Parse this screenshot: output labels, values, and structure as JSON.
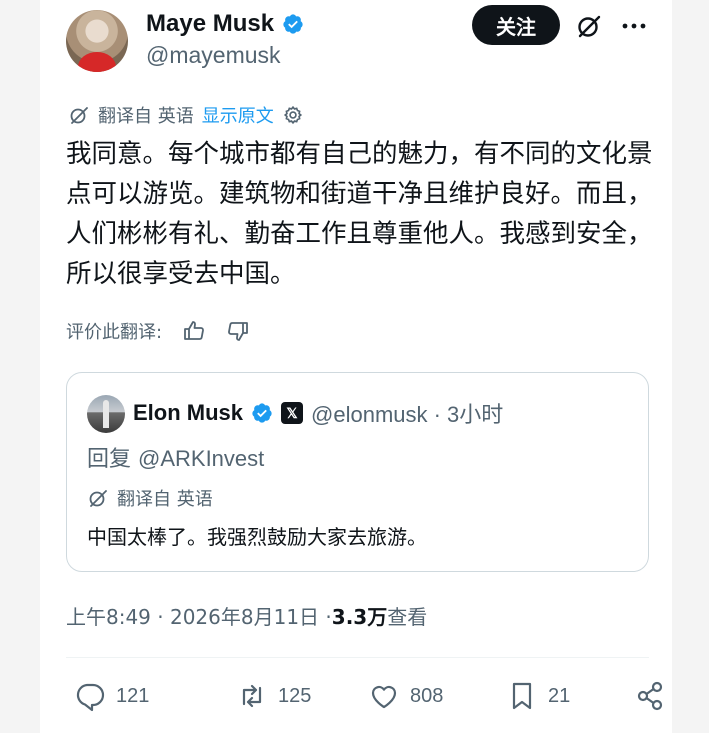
{
  "author": {
    "display_name": "Maye Musk",
    "handle": "@mayemusk"
  },
  "header": {
    "follow_label": "关注"
  },
  "translation": {
    "label": "翻译自 英语",
    "show_original": "显示原文"
  },
  "tweet": {
    "text": "我同意。每个城市都有自己的魅力，有不同的文化景点可以游览。建筑物和街道干净且维护良好。而且，人们彬彬有礼、勤奋工作且尊重他人。我感到安全，所以很享受去中国。"
  },
  "rate": {
    "label": "评价此翻译:"
  },
  "quoted": {
    "display_name": "Elon Musk",
    "handle_time": "@elonmusk · 3小时",
    "reply_prefix": "回复 ",
    "reply_to": "@ARKInvest",
    "translation_label": "翻译自 英语",
    "text": "中国太棒了。我强烈鼓励大家去旅游。"
  },
  "meta": {
    "time_date": "上午8:49 · 2026年8月11日 · ",
    "views_count": "3.3万",
    "views_label": " 查看"
  },
  "actions": {
    "replies": "121",
    "reposts": "125",
    "likes": "808",
    "bookmarks": "21"
  },
  "colors": {
    "accent": "#1d9bf0",
    "text": "#0f1419",
    "secondary": "#536471"
  }
}
